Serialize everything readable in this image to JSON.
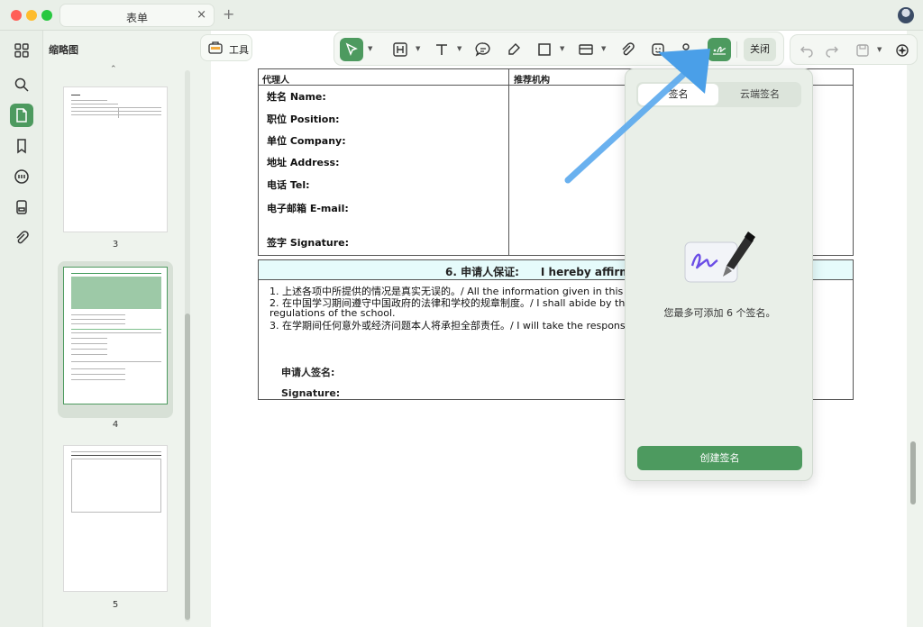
{
  "window": {
    "tab_title": "表单",
    "tab_close": "×",
    "tab_add": "+"
  },
  "sidebar": {
    "title": "缩略图",
    "chevron": "⌃",
    "pages": [
      {
        "label": "3"
      },
      {
        "label": "4"
      },
      {
        "label": "5"
      }
    ],
    "icons": [
      "grid-icon",
      "search-icon",
      "thumbnail-icon",
      "bookmark-icon",
      "comment-icon",
      "form-icon",
      "attachment-icon"
    ]
  },
  "toolbar": {
    "tools_label": "工具",
    "close_label": "关闭",
    "icons": [
      "select-icon",
      "text-box-icon",
      "text-icon",
      "comment-icon",
      "highlight-icon",
      "shape-icon",
      "stamp-icon",
      "attachment-icon",
      "sticker-icon",
      "pen-icon",
      "signature-icon",
      "undo-icon",
      "redo-icon",
      "save-icon",
      "ai-icon"
    ]
  },
  "document": {
    "top_partial": "",
    "form": {
      "left_header": "代理人",
      "right_header": "推荐机构",
      "fields": [
        "姓名 Name:",
        "职位 Position:",
        "单位 Company:",
        "地址 Address:",
        "电话 Tel:",
        "电子邮箱 E-mail:",
        "签字 Signature:"
      ]
    },
    "section6": {
      "title": "6. 申请人保证:　　I hereby affirm",
      "lines": [
        "1. 上述各项中所提供的情况是真实无误的。/ All the information given in this form",
        "2. 在中国学习期间遵守中国政府的法律和学校的规章制度。/ I shall abide by the law",
        "    regulations of the school.",
        "3. 在学期间任何意外或经济问题本人将承担全部责任。/ I will take the responsibiliti"
      ],
      "sign_cn": "申请人签名:",
      "sign_en": "Signature:"
    }
  },
  "signature_panel": {
    "tab_sign": "签名",
    "tab_cloud": "云端签名",
    "message": "您最多可添加 6 个签名。",
    "create_button": "创建签名"
  },
  "colors": {
    "accent": "#4d9a5f",
    "panel_bg": "#e9efe8",
    "section_header": "#e6fbfb",
    "arrow": "#5aa9ee"
  }
}
